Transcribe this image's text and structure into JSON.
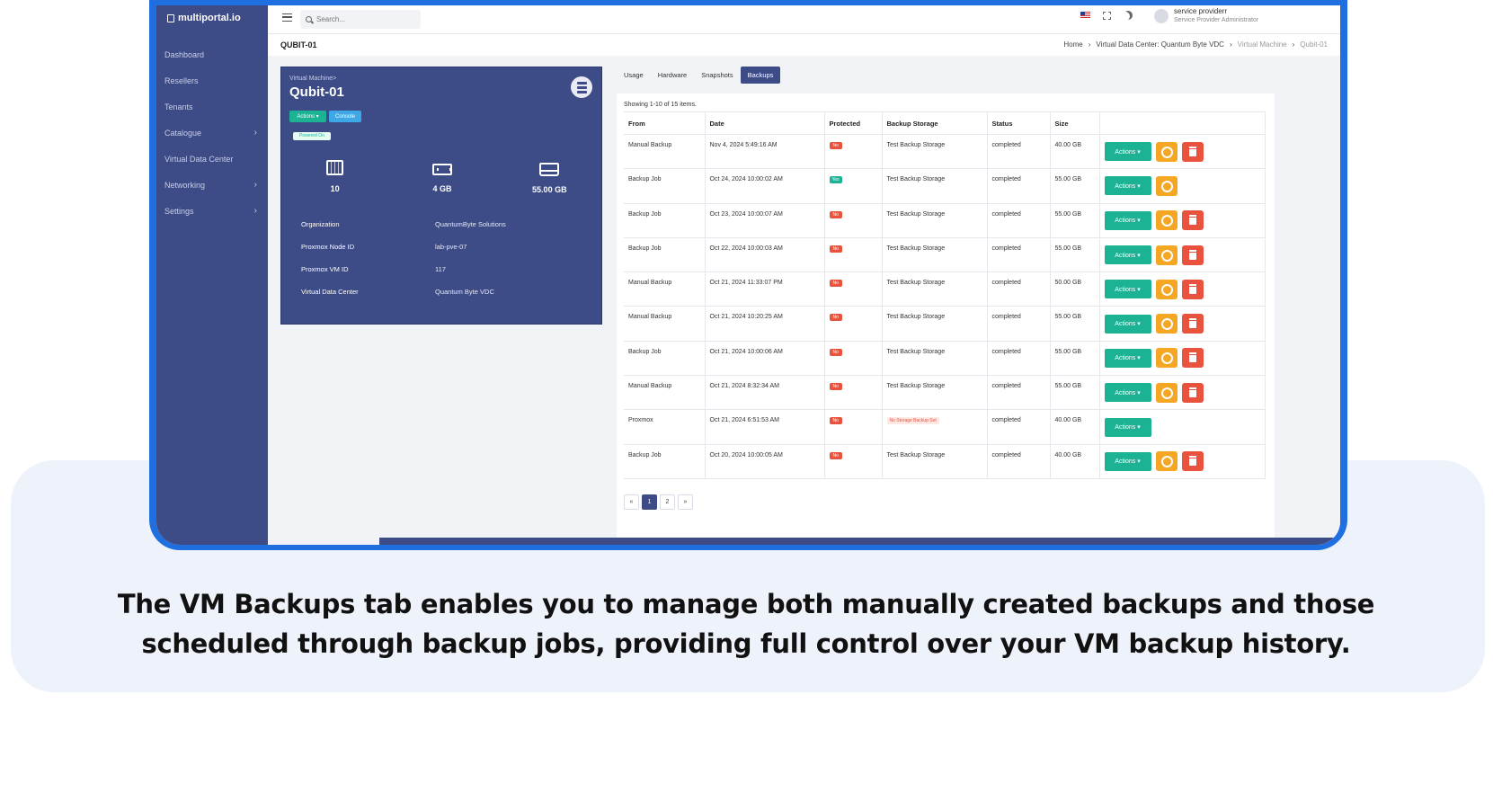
{
  "caption": "The VM Backups tab enables you to manage both manually created backups and those scheduled through backup jobs, providing full control over your VM backup history.",
  "app": {
    "logo": "multiportal.io"
  },
  "sidebar": {
    "items": [
      {
        "label": "Dashboard",
        "has_children": false
      },
      {
        "label": "Resellers",
        "has_children": false
      },
      {
        "label": "Tenants",
        "has_children": false
      },
      {
        "label": "Catalogue",
        "has_children": true
      },
      {
        "label": "Virtual Data Center",
        "has_children": false
      },
      {
        "label": "Networking",
        "has_children": true
      },
      {
        "label": "Settings",
        "has_children": true
      }
    ]
  },
  "topbar": {
    "search_placeholder": "Search...",
    "user_name": "service providerr",
    "user_role": "Service Provider Administrator",
    "icons": [
      "menu-icon",
      "search-icon",
      "flag-icon",
      "fullscreen-icon",
      "moon-icon",
      "avatar-icon"
    ]
  },
  "page": {
    "title": "QUBIT-01",
    "breadcrumb": [
      "Home",
      "Virtual Data Center: Quantum Byte VDC",
      "Virtual Machine",
      "Qubit-01"
    ]
  },
  "vm": {
    "subtitle": "Virtual Machine>",
    "name": "Qubit-01",
    "actions_label": "Actions",
    "console_label": "Console",
    "power_status": "Powered On",
    "stats": {
      "cpu": "10",
      "ram": "4 GB",
      "disk": "55.00 GB"
    },
    "info": [
      {
        "label": "Organization",
        "value": "QuantumByte Solutions"
      },
      {
        "label": "Proxmox Node ID",
        "value": "lab-pve-07"
      },
      {
        "label": "Proxmox VM ID",
        "value": "117"
      },
      {
        "label": "Virtual Data Center",
        "value": "Quantum Byte VDC"
      }
    ]
  },
  "tabs": [
    {
      "label": "Usage",
      "active": false
    },
    {
      "label": "Hardware",
      "active": false
    },
    {
      "label": "Snapshots",
      "active": false
    },
    {
      "label": "Backups",
      "active": true
    }
  ],
  "backups": {
    "summary": "Showing 1-10 of 15 items.",
    "columns": [
      "From",
      "Date",
      "Protected",
      "Backup Storage",
      "Status",
      "Size"
    ],
    "actions_label": "Actions",
    "rows": [
      {
        "from": "Manual Backup",
        "date": "Nov 4, 2024 5:49:16 AM",
        "protected": "No",
        "storage": "Test Backup Storage",
        "status": "completed",
        "size": "40.00 GB",
        "restore": true,
        "delete": true
      },
      {
        "from": "Backup Job",
        "date": "Oct 24, 2024 10:00:02 AM",
        "protected": "Yes",
        "storage": "Test Backup Storage",
        "status": "completed",
        "size": "55.00 GB",
        "restore": true,
        "delete": false
      },
      {
        "from": "Backup Job",
        "date": "Oct 23, 2024 10:00:07 AM",
        "protected": "No",
        "storage": "Test Backup Storage",
        "status": "completed",
        "size": "55.00 GB",
        "restore": true,
        "delete": true
      },
      {
        "from": "Backup Job",
        "date": "Oct 22, 2024 10:00:03 AM",
        "protected": "No",
        "storage": "Test Backup Storage",
        "status": "completed",
        "size": "55.00 GB",
        "restore": true,
        "delete": true
      },
      {
        "from": "Manual Backup",
        "date": "Oct 21, 2024 11:33:07 PM",
        "protected": "No",
        "storage": "Test Backup Storage",
        "status": "completed",
        "size": "50.00 GB",
        "restore": true,
        "delete": true
      },
      {
        "from": "Manual Backup",
        "date": "Oct 21, 2024 10:20:25 AM",
        "protected": "No",
        "storage": "Test Backup Storage",
        "status": "completed",
        "size": "55.00 GB",
        "restore": true,
        "delete": true
      },
      {
        "from": "Backup Job",
        "date": "Oct 21, 2024 10:00:06 AM",
        "protected": "No",
        "storage": "Test Backup Storage",
        "status": "completed",
        "size": "55.00 GB",
        "restore": true,
        "delete": true
      },
      {
        "from": "Manual Backup",
        "date": "Oct 21, 2024 8:32:34 AM",
        "protected": "No",
        "storage": "Test Backup Storage",
        "status": "completed",
        "size": "55.00 GB",
        "restore": true,
        "delete": true
      },
      {
        "from": "Proxmox",
        "date": "Oct 21, 2024 6:51:53 AM",
        "protected": "No",
        "storage": "No Storage Backup Set",
        "status": "completed",
        "size": "40.00 GB",
        "restore": false,
        "delete": false
      },
      {
        "from": "Backup Job",
        "date": "Oct 20, 2024 10:00:05 AM",
        "protected": "No",
        "storage": "Test Backup Storage",
        "status": "completed",
        "size": "40.00 GB",
        "restore": true,
        "delete": true
      }
    ]
  },
  "pagination": {
    "prev": "«",
    "pages": [
      "1",
      "2"
    ],
    "current": "1",
    "next": "»"
  },
  "colors": {
    "primary": "#3d4b86",
    "success": "#1cb394",
    "warning": "#f5a623",
    "danger": "#e9533e",
    "frame": "#1f6fe0"
  }
}
